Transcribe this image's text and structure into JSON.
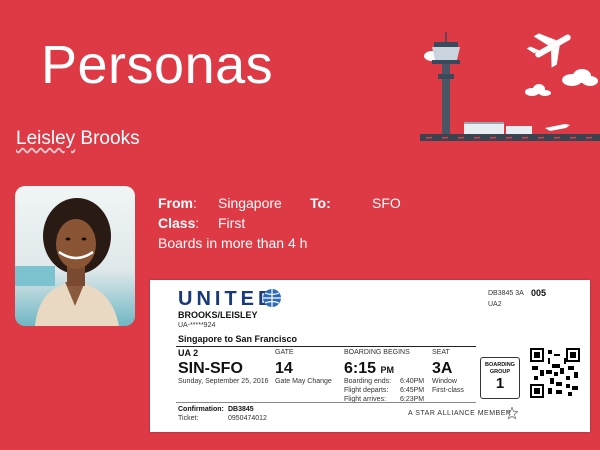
{
  "slide": {
    "title": "Personas",
    "persona_name_underlined": "Leisley",
    "persona_name_rest": " Brooks"
  },
  "info": {
    "from_label": "From",
    "from_sep": ":",
    "from_value": "Singapore",
    "to_label": "To:",
    "to_value": "SFO",
    "class_label": "Class",
    "class_sep": ":",
    "class_value": "First",
    "boards_text": "Boards in more than 4 h"
  },
  "ticket": {
    "brand": "UNITED",
    "flight_ref": "DB3845  3A",
    "flight_ref_num": "005",
    "ua_code": "UA2",
    "passenger": "BROOKS/LEISLEY",
    "passenger_id": "UA-*****924",
    "route_full": "Singapore to San Francisco",
    "flight": "UA 2",
    "gate_label": "GATE",
    "boarding_begins_label": "BOARDING BEGINS",
    "seat_label": "SEAT",
    "route_code": "SIN-SFO",
    "date": "Sunday, September 25, 2016",
    "gate": "14",
    "gate_note": "Gate May Change",
    "boarding_time": "6:15",
    "boarding_pm": "PM",
    "boarding_ends_label": "Boarding ends:",
    "boarding_ends_value": "6:40PM",
    "flight_departs_label": "Flight departs:",
    "flight_departs_value": "6:45PM",
    "flight_arrives_label": "Flight arrives:",
    "flight_arrives_value": "6:23PM",
    "seat": "3A",
    "seat_type": "Window",
    "seat_class": "First-class",
    "boarding_group_label": "BOARDING GROUP",
    "boarding_group_value": "1",
    "confirmation_label": "Confirmation:",
    "confirmation_value": "DB3845",
    "ticket_label": "Ticket:",
    "ticket_value": "0950474012",
    "alliance": "A STAR ALLIANCE MEMBER"
  },
  "colors": {
    "background": "#dd3a46",
    "united_blue": "#1b3a7a"
  },
  "icons": [
    "control-tower-icon",
    "airplane-icon",
    "cloud-icon",
    "globe-icon",
    "star-alliance-icon",
    "qr-code"
  ]
}
